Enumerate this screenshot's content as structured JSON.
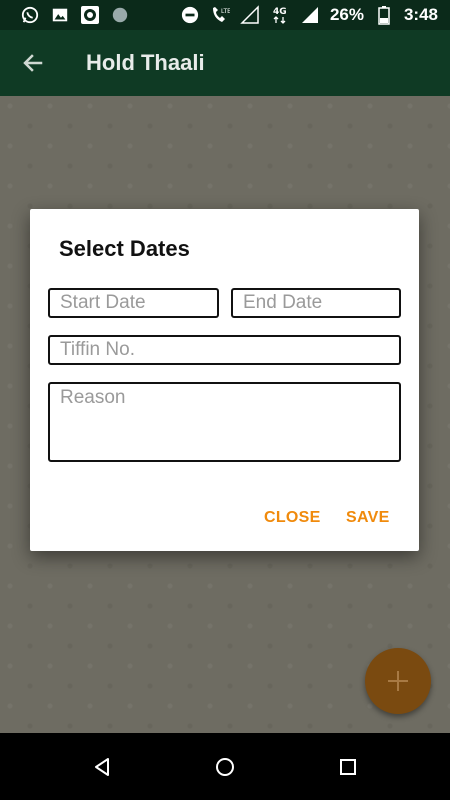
{
  "status_bar": {
    "battery": "26%",
    "time": "3:48",
    "network": "4G"
  },
  "app_bar": {
    "title": "Hold Thaali"
  },
  "dialog": {
    "title": "Select Dates",
    "start_date_placeholder": "Start Date",
    "end_date_placeholder": "End Date",
    "tiffin_placeholder": "Tiffin No.",
    "reason_placeholder": "Reason",
    "close_label": "CLOSE",
    "save_label": "SAVE"
  },
  "colors": {
    "primary": "#0f3a24",
    "accent": "#f08a0c"
  }
}
